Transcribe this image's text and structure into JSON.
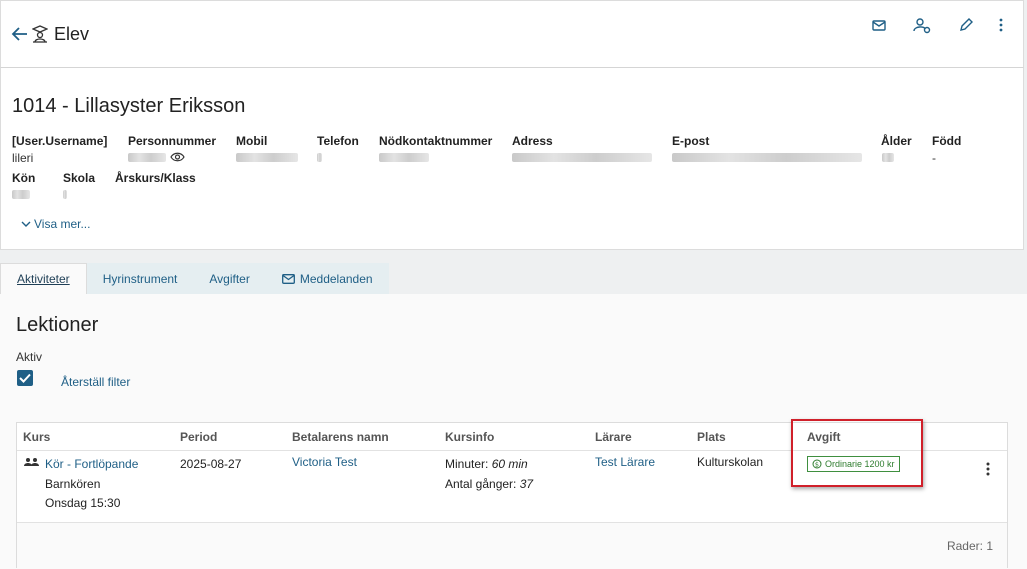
{
  "header": {
    "title": "Elev",
    "actions": [
      "mail-icon",
      "person-settings-icon",
      "edit-icon",
      "more-vert-icon"
    ]
  },
  "student": {
    "name": "1014 - Lillasyster Eriksson",
    "fields": {
      "username_label": "[User.Username]",
      "username_value": "lileri",
      "personnummer_label": "Personnummer",
      "mobil_label": "Mobil",
      "telefon_label": "Telefon",
      "nodkontakt_label": "Nödkontaktnummer",
      "adress_label": "Adress",
      "epost_label": "E-post",
      "alder_label": "Ålder",
      "fodd_label": "Född",
      "fodd_value": "-",
      "kon_label": "Kön",
      "skola_label": "Skola",
      "arskurs_label": "Årskurs/Klass"
    },
    "show_more": "Visa mer..."
  },
  "tabs": [
    {
      "label": "Aktiviteter",
      "active": true
    },
    {
      "label": "Hyrinstrument",
      "active": false
    },
    {
      "label": "Avgifter",
      "active": false
    },
    {
      "label": "Meddelanden",
      "active": false,
      "icon": "mail-icon"
    }
  ],
  "lessons": {
    "title": "Lektioner",
    "filter_label": "Aktiv",
    "filter_checked": true,
    "reset_filter": "Återställ filter",
    "columns": [
      "Kurs",
      "Period",
      "Betalarens namn",
      "Kursinfo",
      "Lärare",
      "Plats",
      "Avgift"
    ],
    "rows": [
      {
        "course_link": "Kör - Fortlöpande",
        "course_group": "Barnkören",
        "course_time": "Onsdag 15:30",
        "period": "2025-08-27",
        "payer": "Victoria Test",
        "minutes_label": "Minuter:",
        "minutes_value": "60 min",
        "times_label": "Antal gånger:",
        "times_value": "37",
        "teacher": "Test Lärare",
        "location": "Kulturskolan",
        "fee": "Ordinarie 1200 kr"
      }
    ],
    "rows_count": "Rader: 1"
  },
  "colors": {
    "accent": "#1f5f86",
    "fee_green": "#2f7d2f",
    "highlight_red": "#d0202a"
  }
}
